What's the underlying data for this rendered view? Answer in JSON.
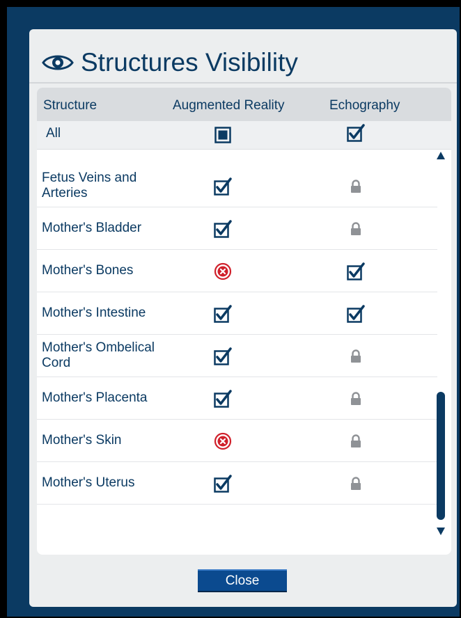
{
  "dialog": {
    "title": "Structures Visibility",
    "title_icon": "eye-icon",
    "close_label": "Close"
  },
  "table": {
    "headers": {
      "structure": "Structure",
      "augmented_reality": "Augmented Reality",
      "echography": "Echography"
    },
    "all_row": {
      "label": "All",
      "augmented_reality": "partial",
      "echography": "checked"
    },
    "rows": [
      {
        "label": "Fetus Veins and Arteries",
        "augmented_reality": "checked",
        "echography": "locked"
      },
      {
        "label": "Mother's Bladder",
        "augmented_reality": "checked",
        "echography": "locked"
      },
      {
        "label": "Mother's Bones",
        "augmented_reality": "hidden",
        "echography": "checked"
      },
      {
        "label": "Mother's Intestine",
        "augmented_reality": "checked",
        "echography": "checked"
      },
      {
        "label": "Mother's Ombelical Cord",
        "augmented_reality": "checked",
        "echography": "locked"
      },
      {
        "label": "Mother's Placenta",
        "augmented_reality": "checked",
        "echography": "locked"
      },
      {
        "label": "Mother's Skin",
        "augmented_reality": "hidden",
        "echography": "locked"
      },
      {
        "label": "Mother's Uterus",
        "augmented_reality": "checked",
        "echography": "locked"
      }
    ]
  },
  "colors": {
    "navy": "#0b3a62",
    "hidden_red": "#d0202b",
    "lock_gray": "#8f9296",
    "button_blue": "#0b4a8f"
  }
}
